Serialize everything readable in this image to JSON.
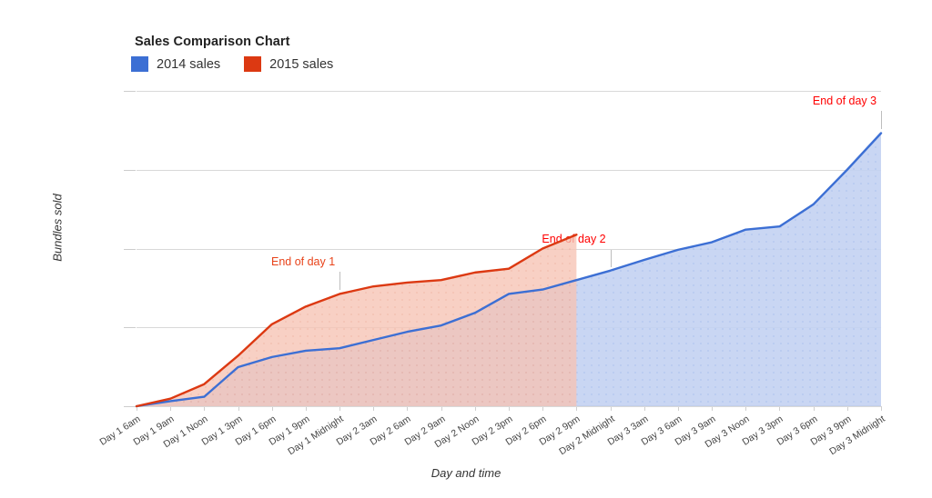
{
  "header": {
    "title": "Sales Comparison Chart"
  },
  "legend": {
    "position": "top-left",
    "entries": [
      {
        "label": "2014 sales",
        "color": "#3c6fd4"
      },
      {
        "label": "2015 sales",
        "color": "#dc3912"
      }
    ]
  },
  "axes": {
    "x_title": "Day and time",
    "y_title": "Bundles sold"
  },
  "annotations": [
    {
      "text": "End of day 1",
      "color": "#e8431a",
      "at_x": "Day 1 Midnight"
    },
    {
      "text": "End of day 2",
      "color": "#ff0000",
      "at_x": "Day 2 Midnight"
    },
    {
      "text": "End of day 3",
      "color": "#ff0000",
      "at_x": "Day 3 Midnight"
    }
  ],
  "chart_data": {
    "type": "area",
    "title": "Sales Comparison Chart",
    "xlabel": "Day and time",
    "ylabel": "Bundles sold",
    "ylim": [
      0,
      500
    ],
    "yticks": [
      0,
      125,
      250,
      375,
      500
    ],
    "grid": true,
    "legend_position": "top-left",
    "categories": [
      "Day 1 6am",
      "Day 1 9am",
      "Day 1 Noon",
      "Day 1 3pm",
      "Day 1 6pm",
      "Day 1 9pm",
      "Day 1 Midnight",
      "Day 2 3am",
      "Day 2 6am",
      "Day 2 9am",
      "Day 2 Noon",
      "Day 2 3pm",
      "Day 2 6pm",
      "Day 2 9pm",
      "Day 2 Midnight",
      "Day 3 3am",
      "Day 3 6am",
      "Day 3 9am",
      "Day 3 Noon",
      "Day 3 3pm",
      "Day 3 6pm",
      "Day 3 9pm",
      "Day 3 Midnight"
    ],
    "series": [
      {
        "name": "2014 sales",
        "color": "#3c6fd4",
        "values": [
          0,
          8,
          15,
          62,
          78,
          88,
          92,
          105,
          118,
          128,
          148,
          178,
          185,
          200,
          215,
          232,
          248,
          260,
          280,
          285,
          320,
          375,
          433
        ]
      },
      {
        "name": "2015 sales",
        "color": "#dc3912",
        "values": [
          0,
          12,
          35,
          80,
          130,
          158,
          178,
          190,
          196,
          200,
          212,
          218,
          250,
          272,
          null,
          null,
          null,
          null,
          null,
          null,
          null,
          null,
          null
        ]
      }
    ]
  }
}
